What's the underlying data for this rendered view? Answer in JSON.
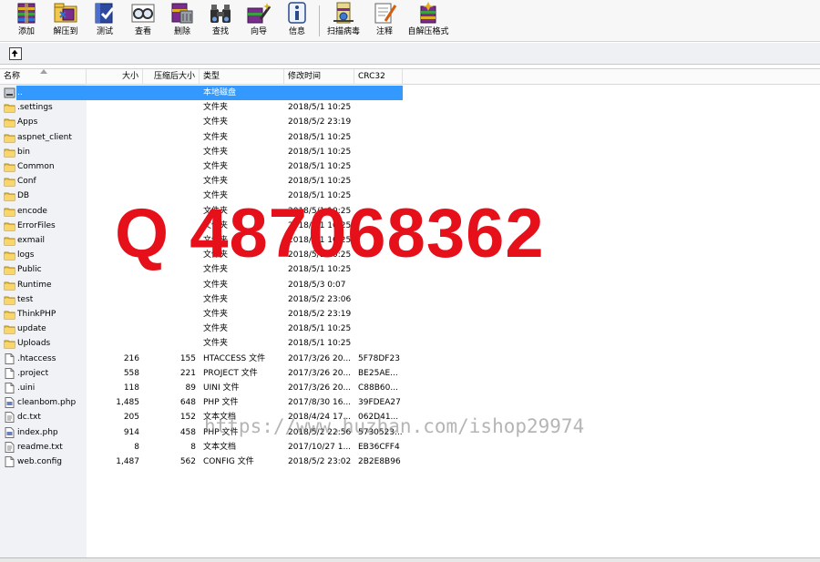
{
  "toolbar": {
    "buttons": [
      {
        "label": "添加",
        "icon": "add-archive-icon"
      },
      {
        "label": "解压到",
        "icon": "extract-to-icon"
      },
      {
        "label": "测试",
        "icon": "test-icon"
      },
      {
        "label": "查看",
        "icon": "view-icon"
      },
      {
        "label": "删除",
        "icon": "delete-icon"
      },
      {
        "label": "查找",
        "icon": "find-icon"
      },
      {
        "label": "向导",
        "icon": "wizard-icon"
      },
      {
        "label": "信息",
        "icon": "info-icon"
      },
      {
        "label": "扫描病毒",
        "icon": "virus-scan-icon"
      },
      {
        "label": "注释",
        "icon": "comment-icon"
      },
      {
        "label": "自解压格式",
        "icon": "sfx-icon"
      }
    ]
  },
  "columns": {
    "name": "名称",
    "size": "大小",
    "packed": "压缩后大小",
    "type": "类型",
    "modified": "修改时间",
    "crc": "CRC32"
  },
  "rows": [
    {
      "name": "..",
      "size": "",
      "packed": "",
      "type": "本地磁盘",
      "date": "",
      "crc": "",
      "kind": "drive",
      "selected": true
    },
    {
      "name": ".settings",
      "size": "",
      "packed": "",
      "type": "文件夹",
      "date": "2018/5/1 10:25",
      "crc": "",
      "kind": "folder"
    },
    {
      "name": "Apps",
      "size": "",
      "packed": "",
      "type": "文件夹",
      "date": "2018/5/2 23:19",
      "crc": "",
      "kind": "folder"
    },
    {
      "name": "aspnet_client",
      "size": "",
      "packed": "",
      "type": "文件夹",
      "date": "2018/5/1 10:25",
      "crc": "",
      "kind": "folder"
    },
    {
      "name": "bin",
      "size": "",
      "packed": "",
      "type": "文件夹",
      "date": "2018/5/1 10:25",
      "crc": "",
      "kind": "folder"
    },
    {
      "name": "Common",
      "size": "",
      "packed": "",
      "type": "文件夹",
      "date": "2018/5/1 10:25",
      "crc": "",
      "kind": "folder"
    },
    {
      "name": "Conf",
      "size": "",
      "packed": "",
      "type": "文件夹",
      "date": "2018/5/1 10:25",
      "crc": "",
      "kind": "folder"
    },
    {
      "name": "DB",
      "size": "",
      "packed": "",
      "type": "文件夹",
      "date": "2018/5/1 10:25",
      "crc": "",
      "kind": "folder"
    },
    {
      "name": "encode",
      "size": "",
      "packed": "",
      "type": "文件夹",
      "date": "2018/5/1 10:25",
      "crc": "",
      "kind": "folder"
    },
    {
      "name": "ErrorFiles",
      "size": "",
      "packed": "",
      "type": "文件夹",
      "date": "2018/5/1 10:25",
      "crc": "",
      "kind": "folder"
    },
    {
      "name": "exmail",
      "size": "",
      "packed": "",
      "type": "文件夹",
      "date": "2018/5/1 10:25",
      "crc": "",
      "kind": "folder"
    },
    {
      "name": "logs",
      "size": "",
      "packed": "",
      "type": "文件夹",
      "date": "2018/5/1 10:25",
      "crc": "",
      "kind": "folder"
    },
    {
      "name": "Public",
      "size": "",
      "packed": "",
      "type": "文件夹",
      "date": "2018/5/1 10:25",
      "crc": "",
      "kind": "folder"
    },
    {
      "name": "Runtime",
      "size": "",
      "packed": "",
      "type": "文件夹",
      "date": "2018/5/3 0:07",
      "crc": "",
      "kind": "folder"
    },
    {
      "name": "test",
      "size": "",
      "packed": "",
      "type": "文件夹",
      "date": "2018/5/2 23:06",
      "crc": "",
      "kind": "folder"
    },
    {
      "name": "ThinkPHP",
      "size": "",
      "packed": "",
      "type": "文件夹",
      "date": "2018/5/2 23:19",
      "crc": "",
      "kind": "folder"
    },
    {
      "name": "update",
      "size": "",
      "packed": "",
      "type": "文件夹",
      "date": "2018/5/1 10:25",
      "crc": "",
      "kind": "folder"
    },
    {
      "name": "Uploads",
      "size": "",
      "packed": "",
      "type": "文件夹",
      "date": "2018/5/1 10:25",
      "crc": "",
      "kind": "folder"
    },
    {
      "name": ".htaccess",
      "size": "216",
      "packed": "155",
      "type": "HTACCESS 文件",
      "date": "2017/3/26 20...",
      "crc": "5F78DF23",
      "kind": "file"
    },
    {
      "name": ".project",
      "size": "558",
      "packed": "221",
      "type": "PROJECT 文件",
      "date": "2017/3/26 20...",
      "crc": "BE25AE...",
      "kind": "file"
    },
    {
      "name": ".uini",
      "size": "118",
      "packed": "89",
      "type": "UINI 文件",
      "date": "2017/3/26 20...",
      "crc": "C88B60...",
      "kind": "file"
    },
    {
      "name": "cleanbom.php",
      "size": "1,485",
      "packed": "648",
      "type": "PHP 文件",
      "date": "2017/8/30 16...",
      "crc": "39FDEA27",
      "kind": "php"
    },
    {
      "name": "dc.txt",
      "size": "205",
      "packed": "152",
      "type": "文本文档",
      "date": "2018/4/24 17...",
      "crc": "062D41...",
      "kind": "txt"
    },
    {
      "name": "index.php",
      "size": "914",
      "packed": "458",
      "type": "PHP 文件",
      "date": "2018/5/2 22:56",
      "crc": "5730523...",
      "kind": "php"
    },
    {
      "name": "readme.txt",
      "size": "8",
      "packed": "8",
      "type": "文本文档",
      "date": "2017/10/27 1...",
      "crc": "EB36CFF4",
      "kind": "txt"
    },
    {
      "name": "web.config",
      "size": "1,487",
      "packed": "562",
      "type": "CONFIG 文件",
      "date": "2018/5/2 23:02",
      "crc": "2B2E8B96",
      "kind": "file"
    }
  ],
  "watermark": {
    "qq": "Q 487068362",
    "url": "https://www.huzhan.com/ishop29974"
  }
}
